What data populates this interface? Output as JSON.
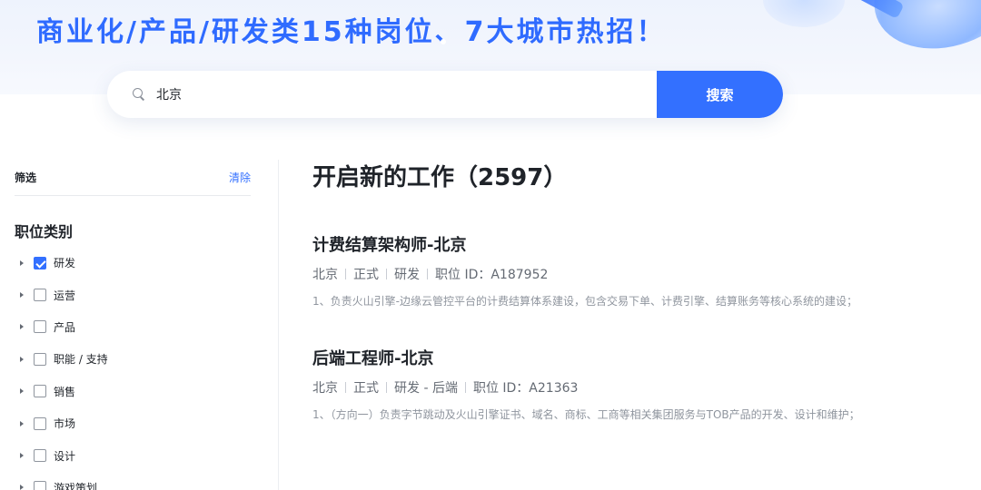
{
  "hero": {
    "title": "商业化/产品/研发类15种岗位、7大城市热招！"
  },
  "search": {
    "value": "北京",
    "button_label": "搜索"
  },
  "sidebar": {
    "filter_title": "筛选",
    "clear_label": "清除",
    "section_title": "职位类别",
    "categories": [
      {
        "label": "研发",
        "checked": true
      },
      {
        "label": "运营",
        "checked": false
      },
      {
        "label": "产品",
        "checked": false
      },
      {
        "label": "职能 / 支持",
        "checked": false
      },
      {
        "label": "销售",
        "checked": false
      },
      {
        "label": "市场",
        "checked": false
      },
      {
        "label": "设计",
        "checked": false
      },
      {
        "label": "游戏策划",
        "checked": false
      }
    ]
  },
  "main": {
    "title": "开启新的工作（2597）",
    "jobs": [
      {
        "title": "计费结算架构师-北京",
        "city": "北京",
        "type": "正式",
        "category": "研发",
        "job_id": "职位 ID：A187952",
        "description": "1、负责火山引擎-边缘云管控平台的计费结算体系建设，包含交易下单、计费引擎、结算账务等核心系统的建设；"
      },
      {
        "title": "后端工程师-北京",
        "city": "北京",
        "type": "正式",
        "category": "研发 - 后端",
        "job_id": "职位 ID：A21363",
        "description": "1、（方向一）负责字节跳动及火山引擎证书、域名、商标、工商等相关集团服务与TOB产品的开发、设计和维护；"
      }
    ]
  },
  "colors": {
    "accent": "#3370ff",
    "hero_title": "#2f6bff"
  }
}
